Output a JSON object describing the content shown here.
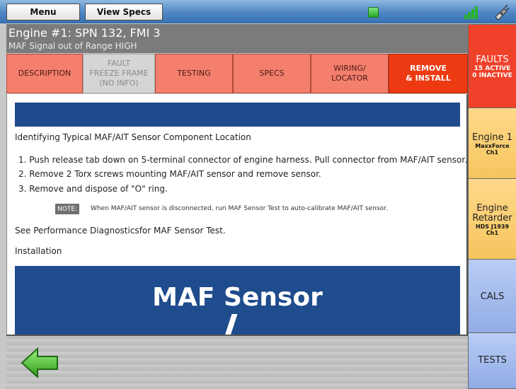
{
  "topbar": {
    "menu_label": "Menu",
    "view_specs_label": "View Specs",
    "status_color": "#2bb52b"
  },
  "header": {
    "title": "Engine #1: SPN 132, FMI 3",
    "subtitle": "MAF Signal out of Range HIGH"
  },
  "tabs": [
    {
      "label": "DESCRIPTION",
      "state": "normal"
    },
    {
      "label": "FAULT\nFREEZE FRAME\n(NO INFO)",
      "state": "disabled"
    },
    {
      "label": "TESTING",
      "state": "normal"
    },
    {
      "label": "SPECS",
      "state": "normal"
    },
    {
      "label": "WIRING/\nLOCATOR",
      "state": "normal"
    },
    {
      "label": "REMOVE\n& INSTALL",
      "state": "active"
    }
  ],
  "content": {
    "heading": "Identifying Typical MAF/AIT Sensor Component Location",
    "steps": [
      "1.  Push release tab down on 5-terminal connector of engine harness. Pull connector from MAF/AIT sensor.",
      "2.  Remove 2 Torx screws mounting MAF/AIT sensor and remove sensor.",
      "3.  Remove and dispose of \"O\" ring."
    ],
    "note_label": "NOTE:",
    "note_text": "When MAF/AIT sensor is disconnected, run MAF Sensor Test to auto-calibrate MAF/AIT sensor.",
    "see_text": "See Performance Diagnosticsfor MAF Sensor Test.",
    "installation": "Installation",
    "image_title": "MAF Sensor"
  },
  "right_tabs": {
    "faults": {
      "main": "FAULTS",
      "sub1": "15 ACTIVE",
      "sub2": "0 INACTIVE"
    },
    "engine1": {
      "main": "Engine 1",
      "sub1": "MaxxForce",
      "sub2": "Ch1"
    },
    "retarder": {
      "main1": "Engine",
      "main2": "Retarder",
      "sub1": "HDS J1939",
      "sub2": "Ch1"
    },
    "cals": {
      "main": "CALS"
    },
    "tests": {
      "main": "TESTS"
    }
  },
  "colors": {
    "accent_red": "#ee3a12",
    "tab_salmon": "#f47f6d",
    "header_gray": "#7b7b7b",
    "panel_blue": "#1f4b8c"
  }
}
